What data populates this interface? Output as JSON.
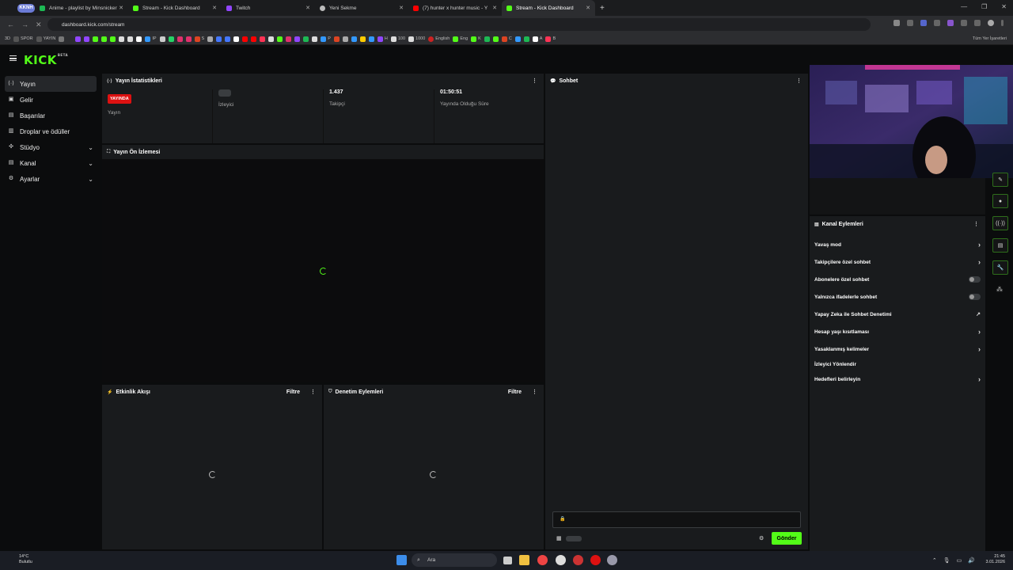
{
  "browser": {
    "tab_group": "KKNH",
    "tabs": [
      {
        "title": "Anime - playlist by Minsnicker",
        "color": "#1db954"
      },
      {
        "title": "Stream - Kick Dashboard",
        "color": "#53fc18"
      },
      {
        "title": "Twitch",
        "color": "#9146ff"
      },
      {
        "title": "Yeni Sekme",
        "color": "#bbbbbb"
      },
      {
        "title": "(7) hunter x hunter music - YouTube",
        "color": "#ff0000"
      },
      {
        "title": "Stream - Kick Dashboard",
        "color": "#53fc18"
      }
    ],
    "url": "dashboard.kick.com/stream",
    "bookmarks": [
      "3D",
      "SPOR",
      "YAYIN",
      "IP",
      "S",
      "P",
      "H",
      "100",
      "1000",
      "English",
      "Eng",
      "K",
      "C",
      "A",
      "B"
    ],
    "all_bookmarks_label": "Tüm Yer İşaretleri"
  },
  "kick": {
    "logo": "KICK",
    "logo_tag": "BETA"
  },
  "sidebar": {
    "items": [
      {
        "label": "Yayın",
        "icon": "broadcast-icon"
      },
      {
        "label": "Gelir",
        "icon": "income-icon"
      },
      {
        "label": "Başarılar",
        "icon": "achievements-icon"
      },
      {
        "label": "Droplar ve ödüller",
        "icon": "gift-icon"
      },
      {
        "label": "Stüdyo",
        "icon": "studio-icon"
      },
      {
        "label": "Kanal",
        "icon": "channel-icon"
      },
      {
        "label": "Ayarlar",
        "icon": "settings-icon"
      }
    ]
  },
  "stats": {
    "title": "Yayın İstatistikleri",
    "live_badge": "YAYINDA",
    "live_label": "Yayın",
    "viewers_label": "İzleyici",
    "followers_value": "1.437",
    "followers_label": "Takipçi",
    "uptime_value": "01:50:51",
    "uptime_label": "Yayında Olduğu Süre"
  },
  "preview": {
    "title": "Yayın Ön İzlemesi"
  },
  "activity": {
    "title": "Etkinlik Akışı",
    "filter": "Filtre"
  },
  "moderation": {
    "title": "Denetim Eylemleri",
    "filter": "Filtre"
  },
  "chat": {
    "title": "Sohbet",
    "send": "Gönder"
  },
  "channel_actions": {
    "title": "Kanal Eylemleri",
    "items": [
      {
        "label": "Yavaş mod",
        "control": "chevron"
      },
      {
        "label": "Takipçilere özel sohbet",
        "control": "chevron"
      },
      {
        "label": "Abonelere özel sohbet",
        "control": "toggle"
      },
      {
        "label": "Yalnızca ifadelerle sohbet",
        "control": "toggle"
      },
      {
        "label": "Yapay Zeka ile Sohbet Denetimi",
        "control": "external"
      },
      {
        "label": "Hesap yaşı kısıtlaması",
        "control": "chevron"
      },
      {
        "label": "Yasaklanmış kelimeler",
        "control": "chevron"
      },
      {
        "label": "İzleyici Yönlendir",
        "control": "none"
      },
      {
        "label": "Hedefleri belirleyin",
        "control": "chevron"
      }
    ]
  },
  "taskbar": {
    "weather_temp": "14°C",
    "weather_desc": "Bulutlu",
    "search": "Ara",
    "time": "21:45",
    "date": "3.01.2026"
  },
  "colors": {
    "kick_green": "#53fc18",
    "live_red": "#dd1111",
    "panel": "#191b1d"
  }
}
